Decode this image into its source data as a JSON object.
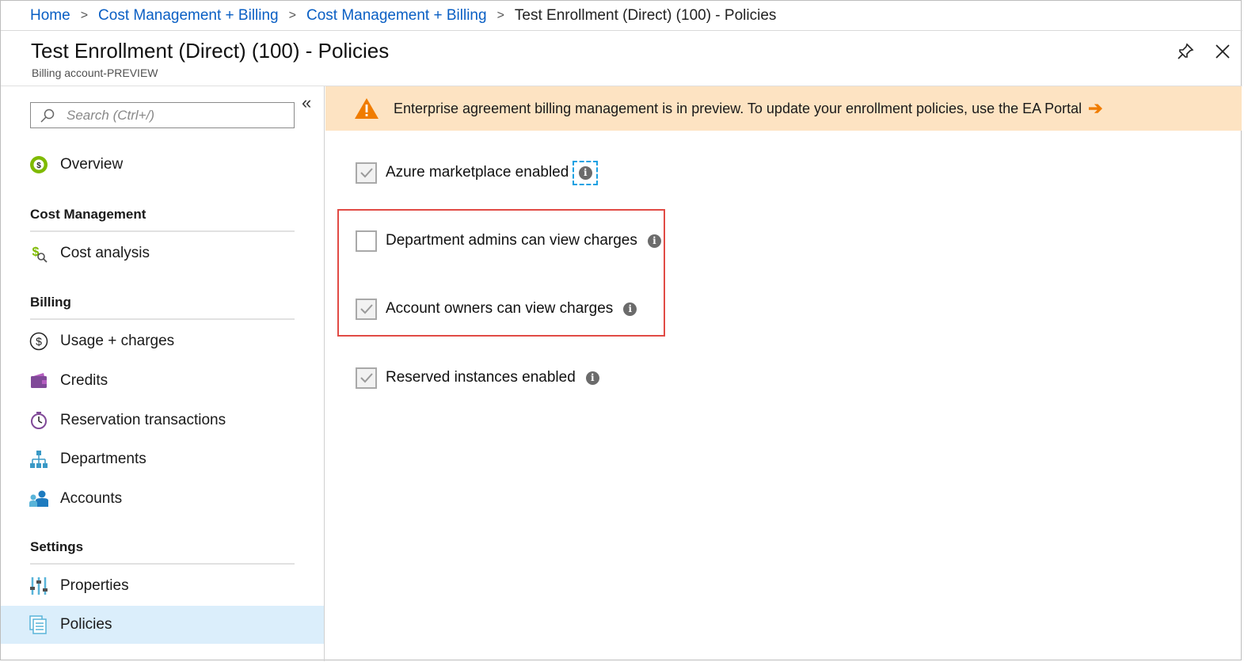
{
  "breadcrumb": {
    "items": [
      "Home",
      "Cost Management + Billing",
      "Cost Management + Billing"
    ],
    "current": "Test Enrollment (Direct) (100) - Policies"
  },
  "header": {
    "title": "Test Enrollment (Direct) (100) - Policies",
    "subtitle": "Billing account-PREVIEW"
  },
  "sidebar": {
    "search_placeholder": "Search (Ctrl+/)",
    "collapse_glyph": "«",
    "overview": "Overview",
    "sections": {
      "cost_management": "Cost Management",
      "billing": "Billing",
      "settings": "Settings"
    },
    "items": {
      "cost_analysis": "Cost analysis",
      "usage_charges": "Usage + charges",
      "credits": "Credits",
      "reservation_transactions": "Reservation transactions",
      "departments": "Departments",
      "accounts": "Accounts",
      "properties": "Properties",
      "policies": "Policies"
    },
    "active_item": "Policies"
  },
  "banner": {
    "message": "Enterprise agreement billing management is in preview. To update your enrollment policies, use the EA Portal",
    "arrow": "➔"
  },
  "policies": [
    {
      "label": "Azure marketplace enabled",
      "checked": true
    },
    {
      "label": "Department admins can view charges",
      "checked": false
    },
    {
      "label": "Account owners can view charges",
      "checked": true
    },
    {
      "label": "Reserved instances enabled",
      "checked": true
    }
  ],
  "colors": {
    "link": "#0a5fc4",
    "banner_bg": "#fde3c2",
    "warning": "#f07c00",
    "highlight_border": "#e14b45",
    "active_nav_bg": "#dbeefb",
    "focus_outline": "#1ba1e2"
  }
}
